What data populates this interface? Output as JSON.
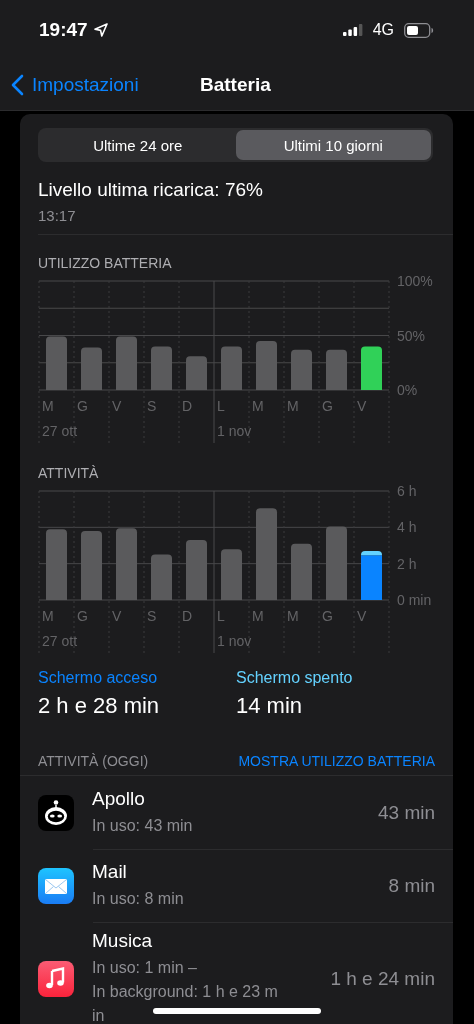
{
  "status_bar": {
    "time": "19:47",
    "network": "4G"
  },
  "nav": {
    "back": "Impostazioni",
    "title": "Batteria"
  },
  "tabs": [
    {
      "label": "Ultime 24 ore",
      "selected": false
    },
    {
      "label": "Ultimi 10 giorni",
      "selected": true
    }
  ],
  "last_charge": {
    "label": "Livello ultima ricarica: 76%",
    "time": "13:17"
  },
  "charts": [
    {
      "title": "UTILIZZO BATTERIA",
      "chart_data": {
        "type": "bar",
        "categories": [
          "M",
          "G",
          "V",
          "S",
          "D",
          "L",
          "M",
          "M",
          "G",
          "V"
        ],
        "stacked": true,
        "ylim": [
          0,
          100
        ],
        "yticks": [
          {
            "value": 0,
            "label": "0%"
          },
          {
            "value": 50,
            "label": "50%"
          },
          {
            "value": 100,
            "label": "100%"
          }
        ],
        "series": [
          {
            "color": "#5a5a5c",
            "values": [
              49,
              39,
              49,
              40,
              31,
              40,
              45,
              37,
              37,
              null
            ]
          },
          {
            "color": "#30d158",
            "values": [
              null,
              null,
              null,
              null,
              null,
              null,
              null,
              null,
              null,
              40
            ]
          }
        ]
      },
      "date_labels": [
        "27 ott",
        "1 nov"
      ]
    },
    {
      "title": "ATTIVITÀ",
      "chart_data": {
        "type": "bar",
        "categories": [
          "M",
          "G",
          "V",
          "S",
          "D",
          "L",
          "M",
          "M",
          "G",
          "V"
        ],
        "stacked": true,
        "ylim": [
          0,
          6
        ],
        "yticks": [
          {
            "value": 0,
            "label": "0 min"
          },
          {
            "value": 2,
            "label": "2 h"
          },
          {
            "value": 4,
            "label": "4 h"
          },
          {
            "value": 6,
            "label": "6 h"
          }
        ],
        "series": [
          {
            "color": "#5a5a5c",
            "values": [
              3.9,
              3.8,
              3.95,
              2.5,
              3.3,
              2.8,
              5.05,
              3.1,
              4.05,
              null
            ]
          },
          {
            "color": "#0a84ff",
            "values": [
              null,
              null,
              null,
              null,
              null,
              null,
              null,
              null,
              null,
              2.47
            ]
          },
          {
            "color": "#64d2ff",
            "values": [
              null,
              null,
              null,
              null,
              null,
              null,
              null,
              null,
              null,
              0.23
            ]
          }
        ]
      },
      "date_labels": [
        "27 ott",
        "1 nov"
      ]
    }
  ],
  "stats": [
    {
      "label": "Schermo acceso",
      "value": "2 h e 28 min",
      "color": "#0a84ff"
    },
    {
      "label": "Schermo spento",
      "value": "14 min",
      "color": "#64d2ff"
    }
  ],
  "activity": {
    "header": "ATTIVITÀ (OGGI)",
    "action": "MOSTRA UTILIZZO BATTERIA"
  },
  "apps": [
    {
      "kind": "apollo",
      "name": "Apollo",
      "details": [
        "In uso: 43 min"
      ],
      "total": "43 min"
    },
    {
      "kind": "mail",
      "name": "Mail",
      "details": [
        "In uso: 8 min"
      ],
      "total": "8 min"
    },
    {
      "kind": "music",
      "name": "Musica",
      "details": [
        "In uso: 1 min –",
        "In background: 1 h e 23 m",
        "in"
      ],
      "total": "1 h e 24 min"
    }
  ]
}
